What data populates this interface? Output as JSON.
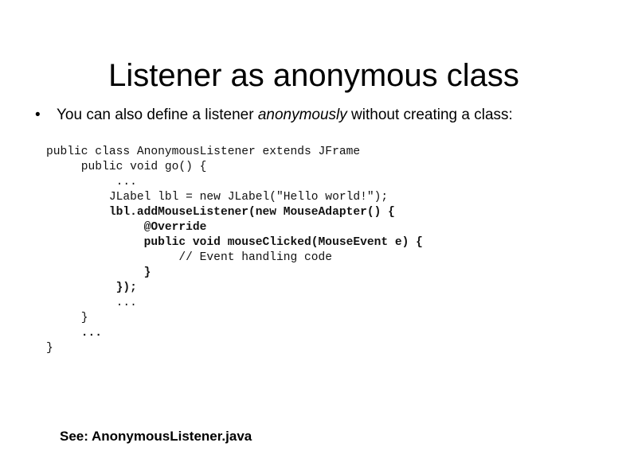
{
  "slide": {
    "title": "Listener as anonymous class",
    "bullet": {
      "marker": "•",
      "before": "You can also define a listener ",
      "emphasis": "anonymously",
      "after": " without creating a class:"
    },
    "code_lines": [
      {
        "text": "public class AnonymousListener extends JFrame",
        "bold": false
      },
      {
        "text": "     public void go() {",
        "bold": false
      },
      {
        "text": "          ...",
        "bold": false
      },
      {
        "text": "         JLabel lbl = new JLabel(\"Hello world!\");",
        "bold": false
      },
      {
        "text": "         lbl.addMouseListener(new MouseAdapter() {",
        "bold": true
      },
      {
        "text": "              @Override",
        "bold": true
      },
      {
        "text": "              public void mouseClicked(MouseEvent e) {",
        "bold": true
      },
      {
        "text": "                   // Event handling code",
        "bold": false
      },
      {
        "text": "              }",
        "bold": true
      },
      {
        "text": "          });",
        "bold": true
      },
      {
        "text": "          ...",
        "bold": false
      },
      {
        "text": "     }",
        "bold": false
      },
      {
        "text": "     ...",
        "bold": true
      },
      {
        "text": "}",
        "bold": false
      }
    ],
    "footer": "See: AnonymousListener.java"
  }
}
